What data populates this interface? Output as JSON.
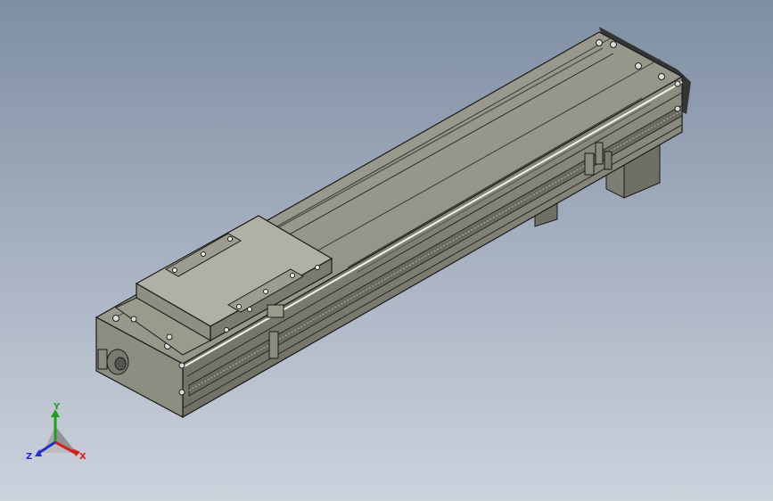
{
  "viewport": {
    "background_top": "#7f8ea3",
    "background_bottom": "#c9d0db",
    "model_body_color": "#8a8a7e",
    "model_edge_color": "#1a1a1a",
    "model_top_color": "#9a9a8d"
  },
  "triad": {
    "x_label": "X",
    "y_label": "Y",
    "z_label": "Z",
    "x_color": "#d42020",
    "y_color": "#1fa01f",
    "z_color": "#2030c8"
  }
}
